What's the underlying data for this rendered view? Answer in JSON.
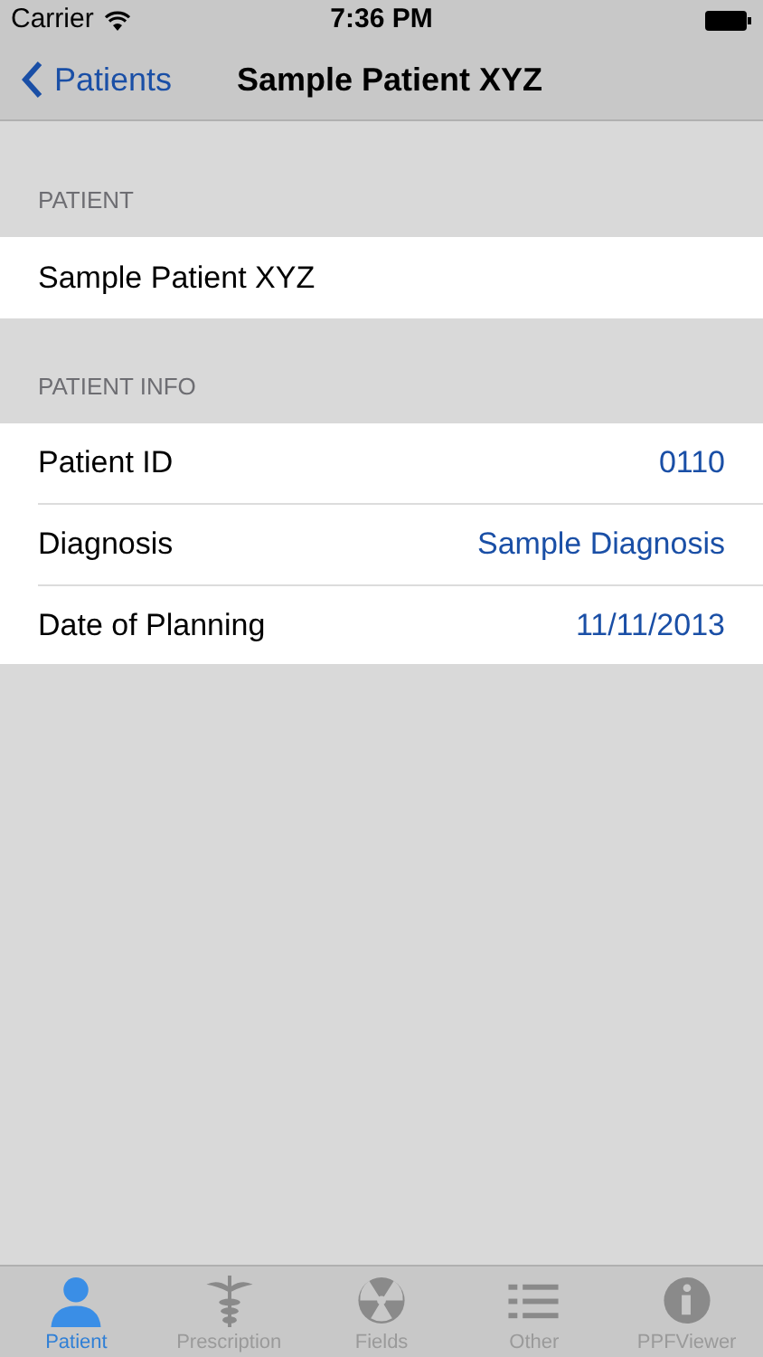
{
  "status_bar": {
    "carrier": "Carrier",
    "time": "7:36 PM"
  },
  "nav": {
    "back": "Patients",
    "title": "Sample Patient XYZ"
  },
  "sections": [
    {
      "header": "PATIENT",
      "rows": [
        {
          "label": "Sample Patient XYZ"
        }
      ]
    },
    {
      "header": "PATIENT INFO",
      "rows": [
        {
          "label": "Patient ID",
          "value": "0110"
        },
        {
          "label": "Diagnosis",
          "value": "Sample Diagnosis"
        },
        {
          "label": "Date of Planning",
          "value": "11/11/2013"
        }
      ]
    }
  ],
  "tabs": [
    {
      "kind": "person",
      "label": "Patient",
      "selected": true
    },
    {
      "kind": "caduceus",
      "label": "Prescription",
      "selected": false
    },
    {
      "kind": "radiation",
      "label": "Fields",
      "selected": false
    },
    {
      "kind": "list",
      "label": "Other",
      "selected": false
    },
    {
      "kind": "info",
      "label": "PPFViewer",
      "selected": false
    }
  ]
}
